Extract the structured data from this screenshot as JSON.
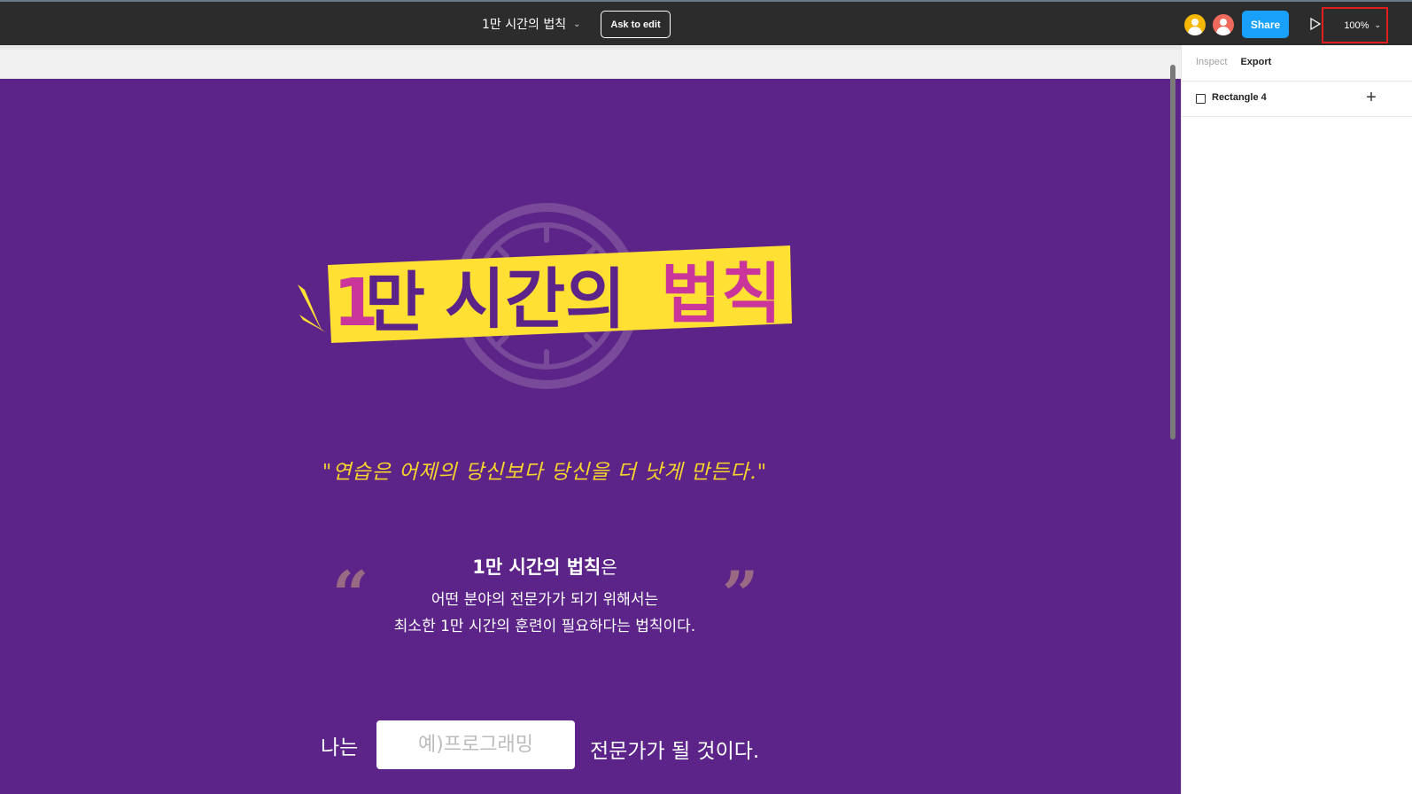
{
  "toolbar": {
    "file_title": "1만 시간의 법칙",
    "ask_to_edit_label": "Ask to edit",
    "share_label": "Share",
    "zoom_label": "100%",
    "colors": {
      "toolbar_bg": "#2c2c2c",
      "share_bg": "#18a0fb",
      "avatar_1": "#f5b700",
      "avatar_2": "#f06a5b",
      "highlight_border": "#e01e1e"
    }
  },
  "design": {
    "frame_bg": "#5c2388",
    "logo": {
      "part_number": "1",
      "part_man": "만",
      "part_sigan": "시간의",
      "part_beopchik": "법칙",
      "colors": {
        "banner_yellow": "#ffe033",
        "text_purple": "#5c2388",
        "accent_pink": "#c9359a"
      }
    },
    "motto": "\"연습은 어제의 당신보다 당신을 더 낫게 만든다.\"",
    "description": {
      "title_bold": "1만 시간의 법칙",
      "title_suffix": "은",
      "line1": "어떤 분야의 전문가가 되기 위해서는",
      "line2": "최소한 1만 시간의 훈련이 필요하다는 법칙이다."
    },
    "quote_open": "“",
    "quote_close": "”",
    "form": {
      "prefix_label": "나는",
      "field_placeholder": "예)프로그래밍",
      "suffix_label": "전문가가 될 것이다."
    }
  },
  "panel": {
    "tabs": [
      {
        "label": "Inspect",
        "active": false
      },
      {
        "label": "Export",
        "active": true
      }
    ],
    "layer_name": "Rectangle 4"
  }
}
